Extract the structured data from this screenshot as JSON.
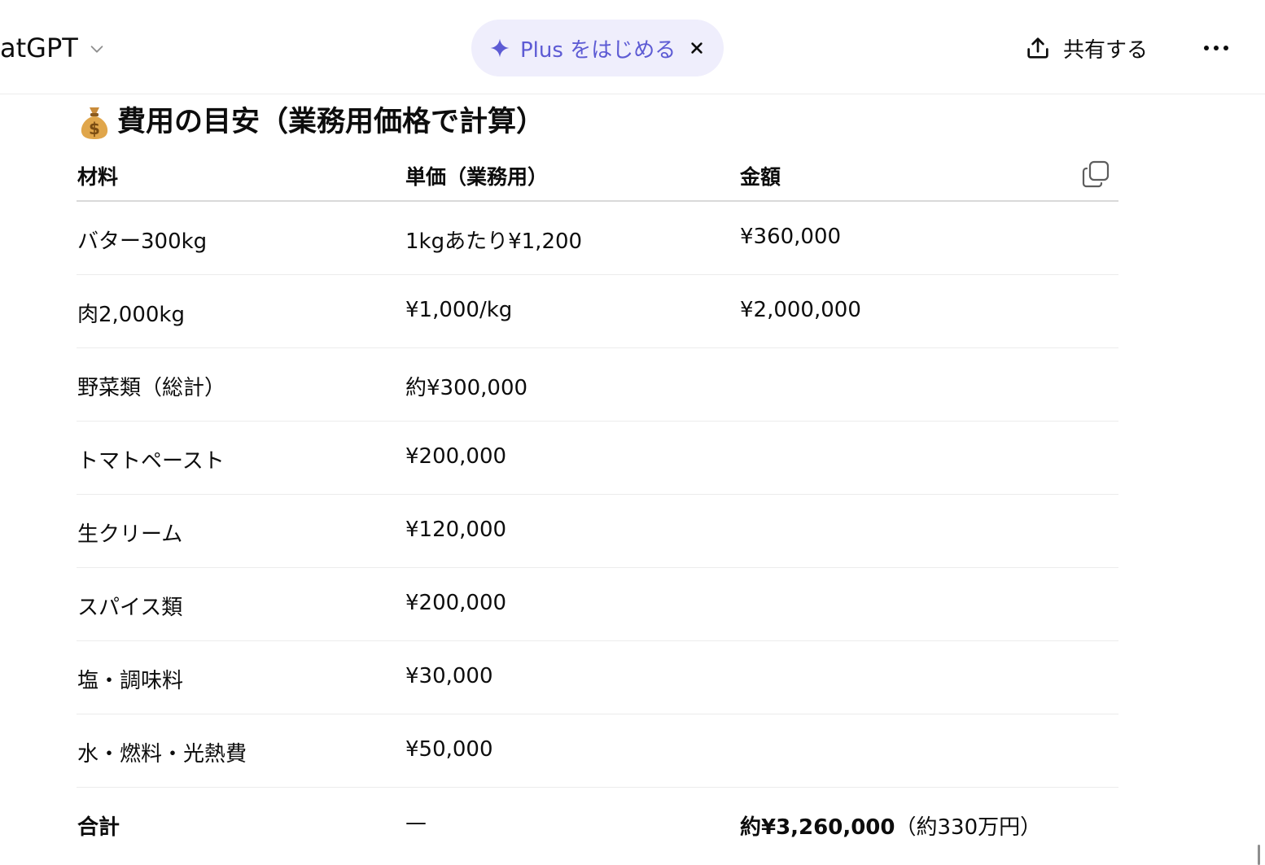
{
  "header": {
    "app_title": "atGPT",
    "plus_label": "Plus をはじめる",
    "share_label": "共有する"
  },
  "section": {
    "emoji": "💰",
    "title": "費用の目安（業務用価格で計算）"
  },
  "table": {
    "columns": [
      "材料",
      "単価（業務用）",
      "金額"
    ],
    "rows": [
      [
        "バター300kg",
        "1kgあたり¥1,200",
        "¥360,000"
      ],
      [
        "肉2,000kg",
        "¥1,000/kg",
        "¥2,000,000"
      ],
      [
        "野菜類（総計）",
        "約¥300,000",
        ""
      ],
      [
        "トマトペースト",
        "¥200,000",
        ""
      ],
      [
        "生クリーム",
        "¥120,000",
        ""
      ],
      [
        "スパイス類",
        "¥200,000",
        ""
      ],
      [
        "塩・調味料",
        "¥30,000",
        ""
      ],
      [
        "水・燃料・光熱費",
        "¥50,000",
        ""
      ]
    ],
    "total": {
      "label": "合計",
      "unit": "—",
      "amount": "約¥3,260,000",
      "note": "（約330万円）"
    }
  },
  "colors": {
    "accent": "#5d5bd4",
    "pill_bg": "#efeefc",
    "divider": "#ececec"
  },
  "icons": {
    "title_dropdown": "chevron-down-icon",
    "plus_sparkle": "sparkle-icon",
    "plus_close": "close-icon",
    "share": "upload-icon",
    "more": "more-horizontal-icon",
    "copy": "copy-icon"
  }
}
